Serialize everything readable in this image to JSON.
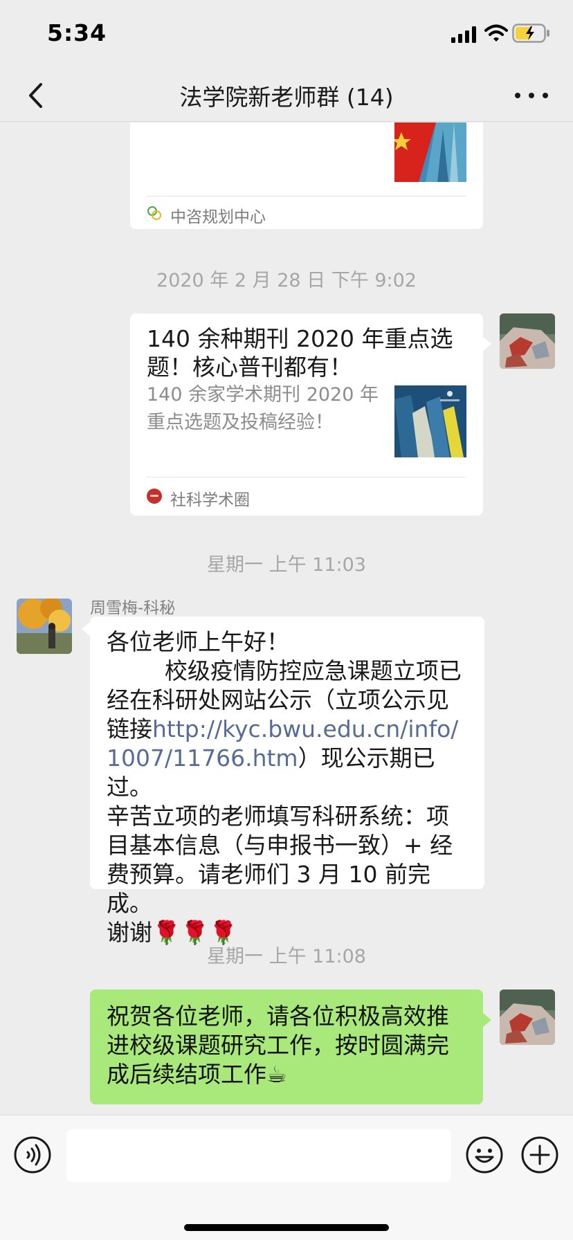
{
  "status_bar": {
    "time": "5:34"
  },
  "nav": {
    "title": "法学院新老师群 (14)"
  },
  "messages": {
    "card1": {
      "source": "中咨规划中心"
    },
    "ts1": "2020 年 2 月 28 日 下午 9:02",
    "card2": {
      "title_line1": "140 余种期刊 2020 年重点选",
      "title_line2": "题！核心普刊都有！",
      "desc_line1": "140 余家学术期刊 2020 年",
      "desc_line2": "重点选题及投稿经验！",
      "source": "社科学术圈"
    },
    "ts2": "星期一 上午 11:03",
    "msg3": {
      "sender": "周雪梅-科秘",
      "line1": "各位老师上午好！",
      "line2": "        校级疫情防控应急课题立项已",
      "line3": "经在科研处网站公示（立项公示见",
      "line4_pre": "链接",
      "link1": "http://kyc.bwu.edu.cn/info/",
      "link2": "1007/11766.htm",
      "line5_post": "）现公示期已过。",
      "line6": "辛苦立项的老师填写科研系统：项",
      "line7": "目基本信息（与申报书一致）+ 经",
      "line8": "费预算。请老师们 3 月 10 前完成。",
      "line9": "谢谢🌹🌹🌹"
    },
    "ts3": "星期一 上午 11:08",
    "msg4": {
      "line1": "祝贺各位老师，请各位积极高效推",
      "line2": "进校级课题研究工作，按时圆满完",
      "line3": "成后续结项工作☕"
    }
  },
  "icons": {
    "back": "chevron-left-icon",
    "more": "more-dots-icon",
    "voice": "voice-icon",
    "emoji": "emoji-icon",
    "plus": "plus-icon"
  },
  "colors": {
    "bubble_green": "#a9e97b",
    "link": "#576b95",
    "background": "#ededed"
  }
}
